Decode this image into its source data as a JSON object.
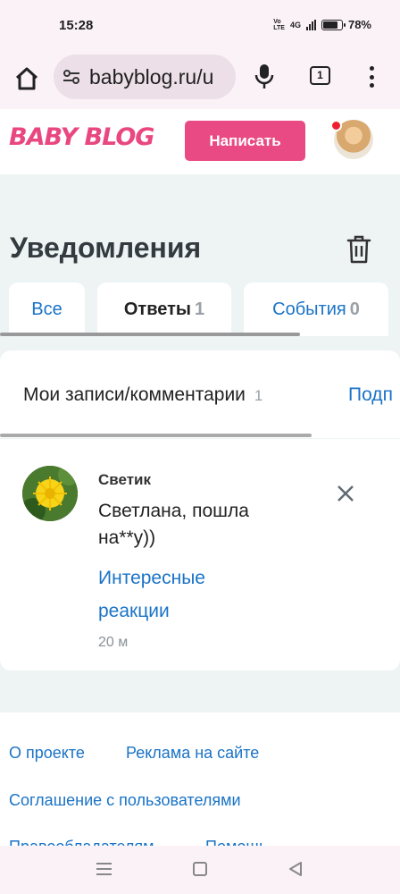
{
  "status_bar": {
    "time": "15:28",
    "volte": "Vo\nLTE",
    "network": "4G",
    "battery_percent_label": "78%",
    "battery_level": 0.78
  },
  "browser": {
    "url": "babyblog.ru/u",
    "tab_count": "1",
    "icons": [
      "home-icon",
      "tune-icon",
      "mic-icon",
      "tabs-icon",
      "more-vert-icon"
    ]
  },
  "site_header": {
    "logo": "BABY BLOG",
    "write_button": "Написать"
  },
  "page": {
    "title": "Уведомления",
    "tabs": [
      {
        "label": "Все",
        "count": ""
      },
      {
        "label": "Ответы",
        "count": "1"
      },
      {
        "label": "События",
        "count": "0"
      }
    ],
    "subtabs": [
      {
        "label": "Мои записи/комментарии",
        "count": "1"
      },
      {
        "label": "Подп",
        "count": ""
      }
    ]
  },
  "notification": {
    "author": "Светик",
    "text": "Светлана, пошла на**у))",
    "link": "Интересные реакции",
    "time": "20 м"
  },
  "footer": {
    "links": [
      "О проекте",
      "Реклама на сайте",
      "Соглашение с пользователями",
      "Правообладателям",
      "Помощь"
    ]
  },
  "colors": {
    "accent_pink": "#ea4a83",
    "link_blue": "#1a73c6",
    "page_bg": "#eef3f4",
    "title_dark": "#333b40"
  }
}
